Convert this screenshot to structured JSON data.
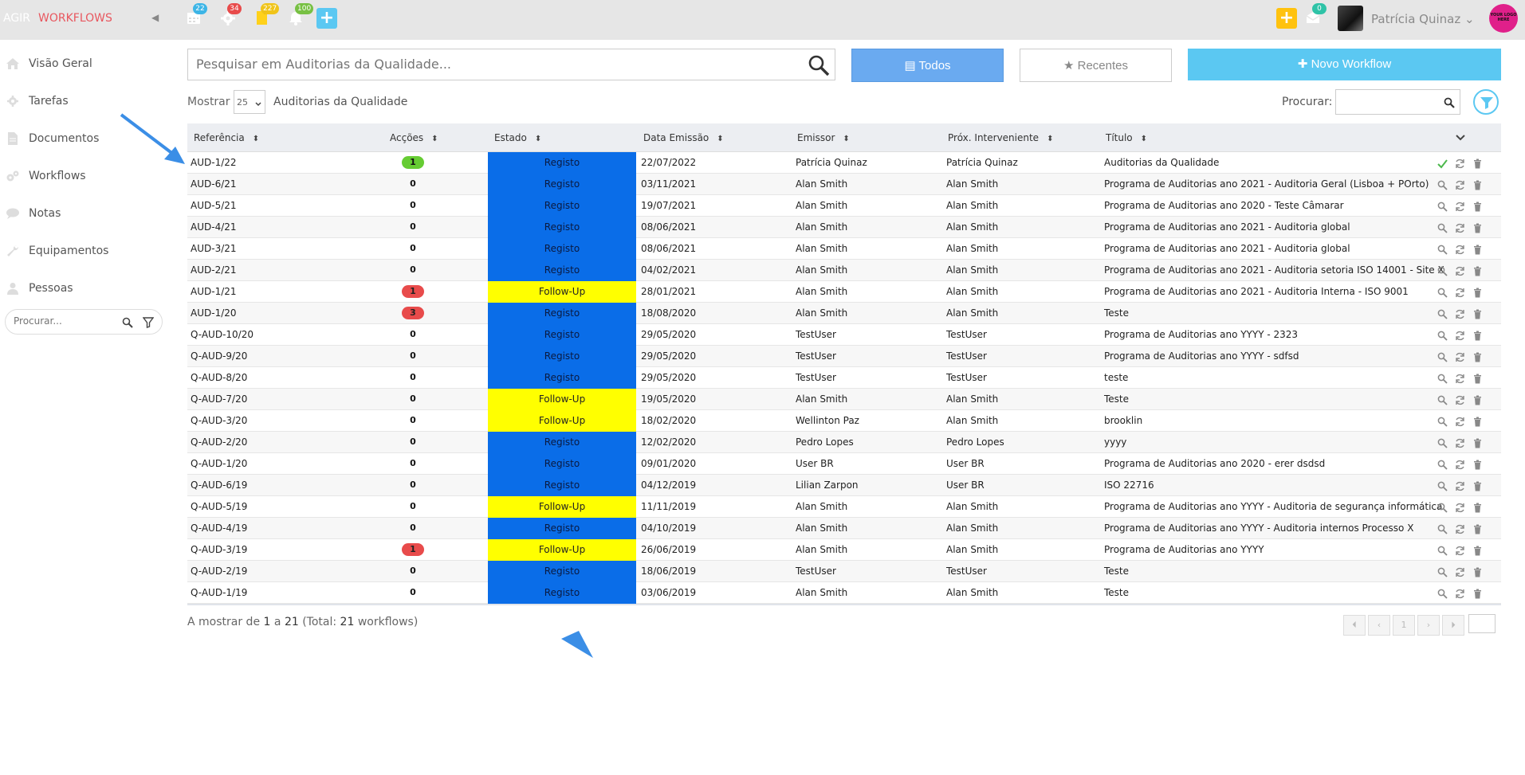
{
  "topbar": {
    "brand_prefix": "AGIR",
    "brand_module": "WORKFLOWS",
    "badges": {
      "calendar": "22",
      "settings": "34",
      "documents": "227",
      "notifications": "100",
      "messages": "0"
    },
    "user_name": "Patrícia Quinaz",
    "logo_text": "YOUR LOGO HERE"
  },
  "sidebar": {
    "items": [
      {
        "label": "Visão Geral",
        "icon": "home-icon"
      },
      {
        "label": "Tarefas",
        "icon": "gear-icon"
      },
      {
        "label": "Documentos",
        "icon": "document-icon"
      },
      {
        "label": "Workflows",
        "icon": "gears-icon"
      },
      {
        "label": "Notas",
        "icon": "chat-icon"
      },
      {
        "label": "Equipamentos",
        "icon": "wrench-icon"
      },
      {
        "label": "Pessoas",
        "icon": "person-icon"
      }
    ],
    "search_placeholder": "Procurar..."
  },
  "main": {
    "search_placeholder": "Pesquisar em Auditorias da Qualidade...",
    "btn_todos": "Todos",
    "btn_recentes": "Recentes",
    "btn_novo": "Novo Workflow",
    "mostrar_label": "Mostrar",
    "page_size": "25",
    "module_name": "Auditorias da Qualidade",
    "procurar_label": "Procurar:"
  },
  "table": {
    "headers": [
      "Referência",
      "Acções",
      "Estado",
      "Data Emissão",
      "Emissor",
      "Próx. Interveniente",
      "Título"
    ],
    "rows": [
      {
        "ref": "AUD-1/22",
        "acc": "1",
        "acc_style": "green",
        "estado": "Registo",
        "data": "22/07/2022",
        "emissor": "Patrícia Quinaz",
        "prox": "Patrícia Quinaz",
        "titulo": "Auditorias da Qualidade",
        "first_action": "check"
      },
      {
        "ref": "AUD-6/21",
        "acc": "0",
        "acc_style": "plain",
        "estado": "Registo",
        "data": "03/11/2021",
        "emissor": "Alan Smith",
        "prox": "Alan Smith",
        "titulo": "Programa de Auditorias ano 2021 - Auditoria Geral (Lisboa + POrto)",
        "first_action": "search"
      },
      {
        "ref": "AUD-5/21",
        "acc": "0",
        "acc_style": "plain",
        "estado": "Registo",
        "data": "19/07/2021",
        "emissor": "Alan Smith",
        "prox": "Alan Smith",
        "titulo": "Programa de Auditorias ano 2020 - Teste Câmarar",
        "first_action": "search"
      },
      {
        "ref": "AUD-4/21",
        "acc": "0",
        "acc_style": "plain",
        "estado": "Registo",
        "data": "08/06/2021",
        "emissor": "Alan Smith",
        "prox": "Alan Smith",
        "titulo": "Programa de Auditorias ano 2021 - Auditoria global",
        "first_action": "search"
      },
      {
        "ref": "AUD-3/21",
        "acc": "0",
        "acc_style": "plain",
        "estado": "Registo",
        "data": "08/06/2021",
        "emissor": "Alan Smith",
        "prox": "Alan Smith",
        "titulo": "Programa de Auditorias ano 2021 - Auditoria global",
        "first_action": "search"
      },
      {
        "ref": "AUD-2/21",
        "acc": "0",
        "acc_style": "plain",
        "estado": "Registo",
        "data": "04/02/2021",
        "emissor": "Alan Smith",
        "prox": "Alan Smith",
        "titulo": "Programa de Auditorias ano 2021 - Auditoria setoria ISO 14001 - Site X",
        "first_action": "search"
      },
      {
        "ref": "AUD-1/21",
        "acc": "1",
        "acc_style": "red",
        "estado": "Follow-Up",
        "data": "28/01/2021",
        "emissor": "Alan Smith",
        "prox": "Alan Smith",
        "titulo": "Programa de Auditorias ano 2021 - Auditoria Interna - ISO 9001",
        "first_action": "search"
      },
      {
        "ref": "AUD-1/20",
        "acc": "3",
        "acc_style": "red",
        "estado": "Registo",
        "data": "18/08/2020",
        "emissor": "Alan Smith",
        "prox": "Alan Smith",
        "titulo": "Teste",
        "first_action": "search"
      },
      {
        "ref": "Q-AUD-10/20",
        "acc": "0",
        "acc_style": "plain",
        "estado": "Registo",
        "data": "29/05/2020",
        "emissor": "TestUser",
        "prox": "TestUser",
        "titulo": "Programa de Auditorias ano YYYY - 2323",
        "first_action": "search"
      },
      {
        "ref": "Q-AUD-9/20",
        "acc": "0",
        "acc_style": "plain",
        "estado": "Registo",
        "data": "29/05/2020",
        "emissor": "TestUser",
        "prox": "TestUser",
        "titulo": "Programa de Auditorias ano YYYY - sdfsd",
        "first_action": "search"
      },
      {
        "ref": "Q-AUD-8/20",
        "acc": "0",
        "acc_style": "plain",
        "estado": "Registo",
        "data": "29/05/2020",
        "emissor": "TestUser",
        "prox": "TestUser",
        "titulo": "teste",
        "first_action": "search"
      },
      {
        "ref": "Q-AUD-7/20",
        "acc": "0",
        "acc_style": "plain",
        "estado": "Follow-Up",
        "data": "19/05/2020",
        "emissor": "Alan Smith",
        "prox": "Alan Smith",
        "titulo": "Teste",
        "first_action": "search"
      },
      {
        "ref": "Q-AUD-3/20",
        "acc": "0",
        "acc_style": "plain",
        "estado": "Follow-Up",
        "data": "18/02/2020",
        "emissor": "Wellinton Paz",
        "prox": "Alan Smith",
        "titulo": "brooklin",
        "first_action": "search"
      },
      {
        "ref": "Q-AUD-2/20",
        "acc": "0",
        "acc_style": "plain",
        "estado": "Registo",
        "data": "12/02/2020",
        "emissor": "Pedro Lopes",
        "prox": "Pedro Lopes",
        "titulo": "yyyy",
        "first_action": "search"
      },
      {
        "ref": "Q-AUD-1/20",
        "acc": "0",
        "acc_style": "plain",
        "estado": "Registo",
        "data": "09/01/2020",
        "emissor": "User BR",
        "prox": "User BR",
        "titulo": "Programa de Auditorias ano 2020 - erer dsdsd",
        "first_action": "search"
      },
      {
        "ref": "Q-AUD-6/19",
        "acc": "0",
        "acc_style": "plain",
        "estado": "Registo",
        "data": "04/12/2019",
        "emissor": "Lilian Zarpon",
        "prox": "User BR",
        "titulo": "ISO 22716",
        "first_action": "search"
      },
      {
        "ref": "Q-AUD-5/19",
        "acc": "0",
        "acc_style": "plain",
        "estado": "Follow-Up",
        "data": "11/11/2019",
        "emissor": "Alan Smith",
        "prox": "Alan Smith",
        "titulo": "Programa de Auditorias ano YYYY - Auditoria de segurança informática",
        "first_action": "search"
      },
      {
        "ref": "Q-AUD-4/19",
        "acc": "0",
        "acc_style": "plain",
        "estado": "Registo",
        "data": "04/10/2019",
        "emissor": "Alan Smith",
        "prox": "Alan Smith",
        "titulo": "Programa de Auditorias ano YYYY - Auditoria internos Processo X",
        "first_action": "search"
      },
      {
        "ref": "Q-AUD-3/19",
        "acc": "1",
        "acc_style": "red",
        "estado": "Follow-Up",
        "data": "26/06/2019",
        "emissor": "Alan Smith",
        "prox": "Alan Smith",
        "titulo": "Programa de Auditorias ano YYYY",
        "first_action": "search"
      },
      {
        "ref": "Q-AUD-2/19",
        "acc": "0",
        "acc_style": "plain",
        "estado": "Registo",
        "data": "18/06/2019",
        "emissor": "TestUser",
        "prox": "TestUser",
        "titulo": "Teste",
        "first_action": "search"
      },
      {
        "ref": "Q-AUD-1/19",
        "acc": "0",
        "acc_style": "plain",
        "estado": "Registo",
        "data": "03/06/2019",
        "emissor": "Alan Smith",
        "prox": "Alan Smith",
        "titulo": "Teste",
        "first_action": "search"
      }
    ]
  },
  "footer": {
    "prefix": "A mostrar de",
    "from": "1",
    "sep": "a",
    "to": "21",
    "total_prefix": "(Total:",
    "total": "21",
    "total_suffix": "workflows)",
    "current_page": "1"
  },
  "colors": {
    "registo": "#0a6de8",
    "follow_up": "#ffff00",
    "accent": "#5bc8f2",
    "brand": "#e8575f"
  }
}
